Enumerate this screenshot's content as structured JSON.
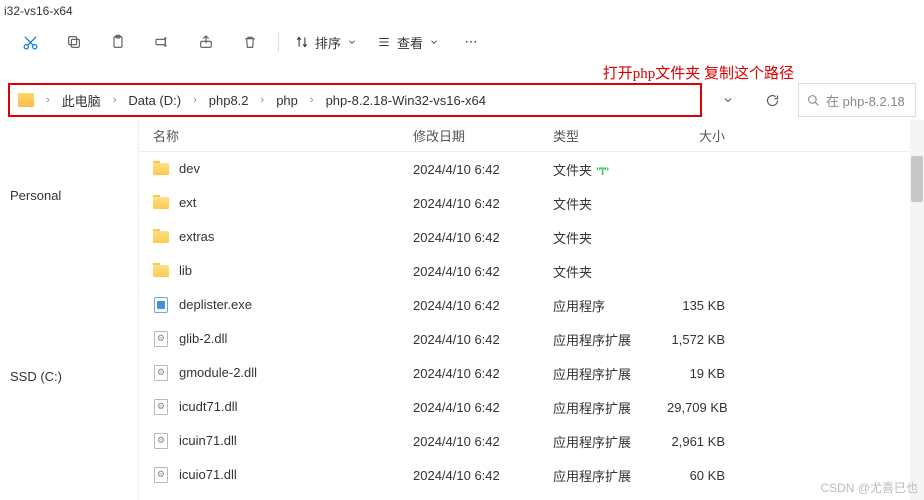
{
  "window": {
    "title_suffix": "i32-vs16-x64"
  },
  "toolbar": {
    "sort_label": "排序",
    "view_label": "查看"
  },
  "annotation": "打开php文件夹 复制这个路径",
  "breadcrumb": [
    "此电脑",
    "Data (D:)",
    "php8.2",
    "php",
    "php-8.2.18-Win32-vs16-x64"
  ],
  "search": {
    "placeholder": "在 php-8.2.18"
  },
  "sidebar": {
    "items": [
      {
        "label": "Personal"
      },
      {
        "label": "SSD (C:)"
      }
    ]
  },
  "columns": {
    "name": "名称",
    "date": "修改日期",
    "type": "类型",
    "size": "大小"
  },
  "type_labels": {
    "folder": "文件夹",
    "exe": "应用程序",
    "dll": "应用程序扩展"
  },
  "files": [
    {
      "name": "dev",
      "date": "2024/4/10 6:42",
      "kind": "folder",
      "size": "",
      "badge": true
    },
    {
      "name": "ext",
      "date": "2024/4/10 6:42",
      "kind": "folder",
      "size": ""
    },
    {
      "name": "extras",
      "date": "2024/4/10 6:42",
      "kind": "folder",
      "size": ""
    },
    {
      "name": "lib",
      "date": "2024/4/10 6:42",
      "kind": "folder",
      "size": ""
    },
    {
      "name": "deplister.exe",
      "date": "2024/4/10 6:42",
      "kind": "exe",
      "size": "135 KB"
    },
    {
      "name": "glib-2.dll",
      "date": "2024/4/10 6:42",
      "kind": "dll",
      "size": "1,572 KB"
    },
    {
      "name": "gmodule-2.dll",
      "date": "2024/4/10 6:42",
      "kind": "dll",
      "size": "19 KB"
    },
    {
      "name": "icudt71.dll",
      "date": "2024/4/10 6:42",
      "kind": "dll",
      "size": "29,709 KB"
    },
    {
      "name": "icuin71.dll",
      "date": "2024/4/10 6:42",
      "kind": "dll",
      "size": "2,961 KB"
    },
    {
      "name": "icuio71.dll",
      "date": "2024/4/10 6:42",
      "kind": "dll",
      "size": "60 KB"
    }
  ],
  "watermark": "CSDN @尤喜巳也"
}
